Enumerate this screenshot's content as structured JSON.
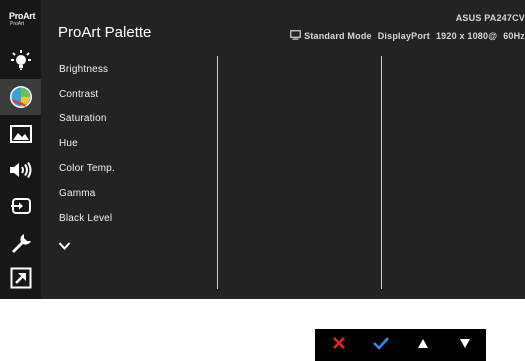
{
  "logo": {
    "line1": "ProArt",
    "line2": "ProArt"
  },
  "header": {
    "title": "ProArt Palette",
    "model": "ASUS PA247CV",
    "mode": "Standard Mode",
    "input": "DisplayPort",
    "resolution": "1920 x 1080@",
    "refresh": "60Hz"
  },
  "sidebar": {
    "items": [
      {
        "icon": "brightness-bulb-icon"
      },
      {
        "icon": "palette-icon",
        "active": true
      },
      {
        "icon": "image-icon"
      },
      {
        "icon": "sound-icon"
      },
      {
        "icon": "input-select-icon"
      },
      {
        "icon": "wrench-icon"
      },
      {
        "icon": "shortcut-icon"
      }
    ]
  },
  "menu": {
    "items": [
      "Brightness",
      "Contrast",
      "Saturation",
      "Hue",
      "Color Temp.",
      "Gamma",
      "Black Level"
    ]
  },
  "keys": {
    "close_color": "#e0242a",
    "confirm_color": "#2d8ee6",
    "arrow_color": "#ffffff"
  }
}
